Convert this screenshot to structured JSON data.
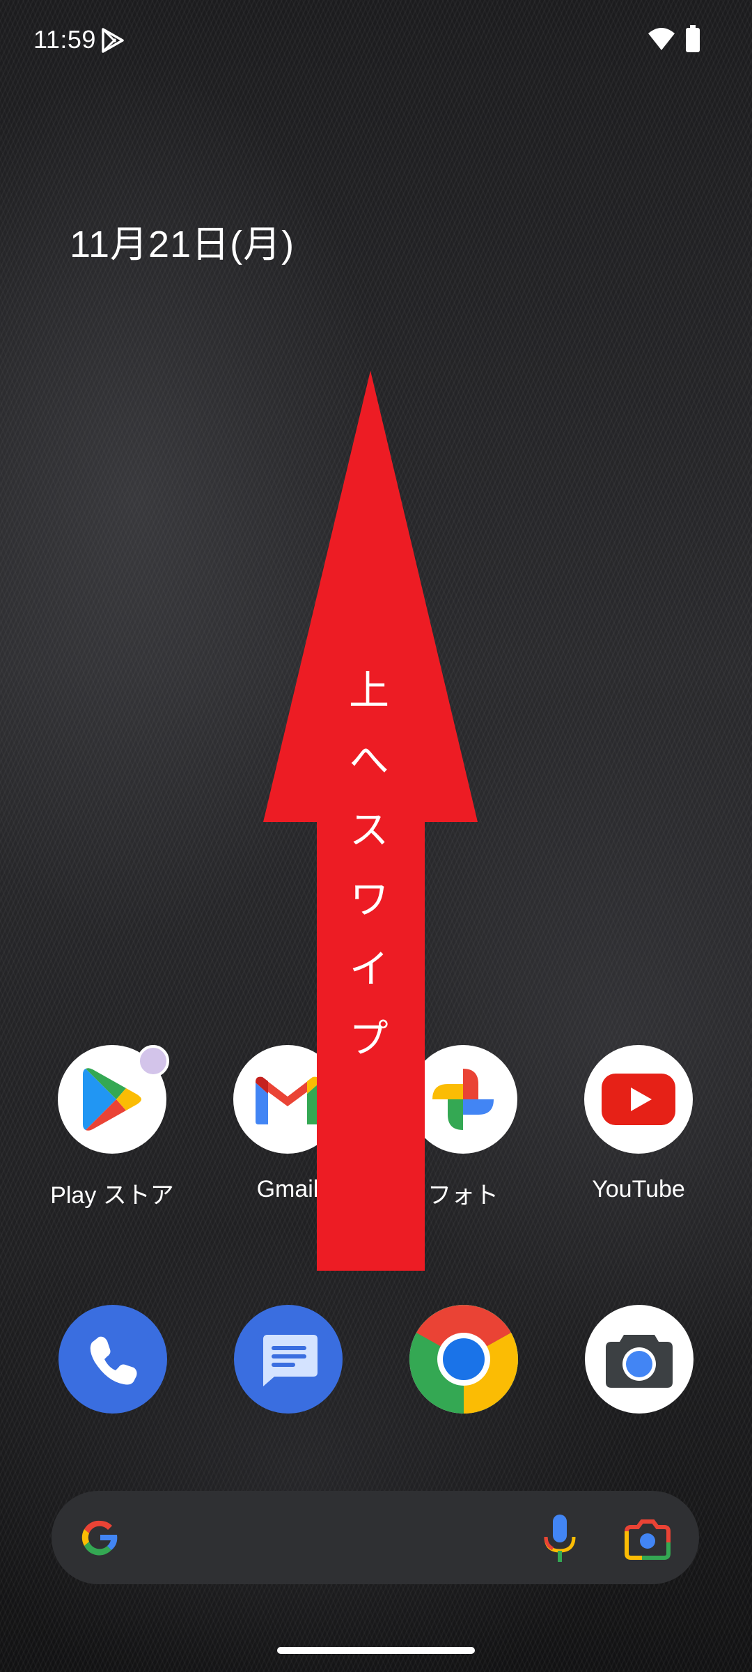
{
  "status_bar": {
    "time": "11:59",
    "icons": [
      "play-store-notification-icon",
      "wifi-icon",
      "battery-icon"
    ]
  },
  "date_widget": {
    "text": "11月21日(月)"
  },
  "home_apps": [
    {
      "label": "Play ストア",
      "icon": "play-store-icon",
      "has_badge": true
    },
    {
      "label": "Gmail",
      "icon": "gmail-icon"
    },
    {
      "label": "フォト",
      "icon": "photos-icon"
    },
    {
      "label": "YouTube",
      "icon": "youtube-icon"
    }
  ],
  "dock_apps": [
    {
      "icon": "phone-icon",
      "color": "#3a6ee0"
    },
    {
      "icon": "messages-icon",
      "color": "#3a6ee0"
    },
    {
      "icon": "chrome-icon",
      "color": "#ffffff"
    },
    {
      "icon": "camera-icon",
      "color": "#ffffff"
    }
  ],
  "search_bar": {
    "icons": [
      "google-g-icon",
      "microphone-icon",
      "google-lens-icon"
    ]
  },
  "overlay": {
    "instruction": "上へスワイプ",
    "arrow_color": "#ed1c24"
  }
}
